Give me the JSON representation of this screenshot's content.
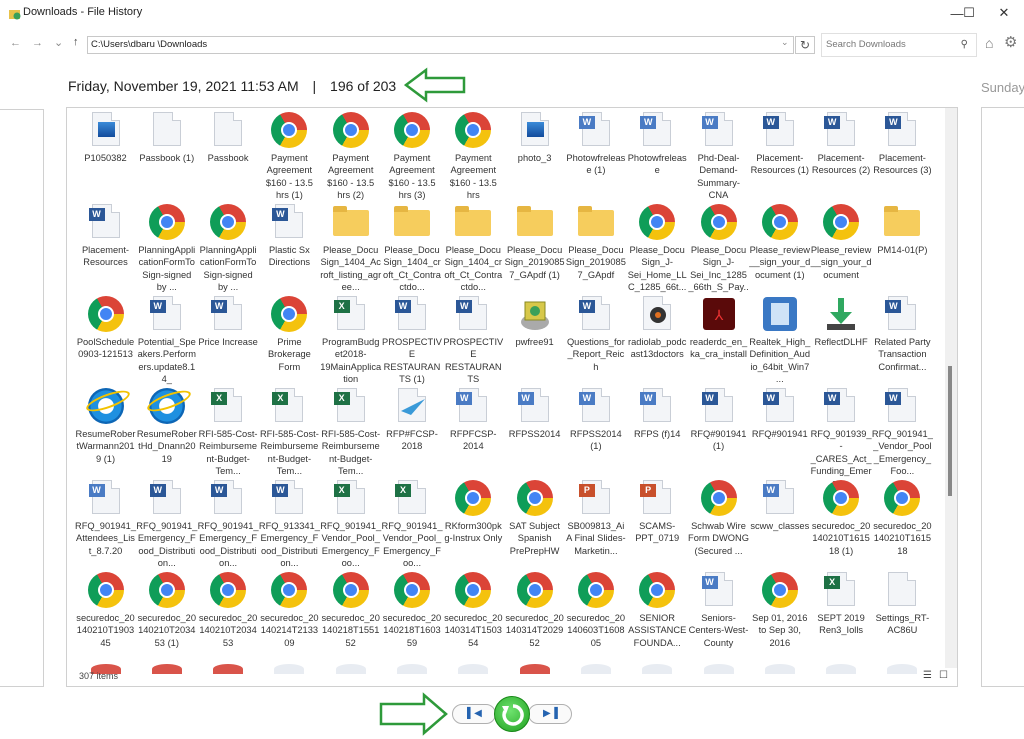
{
  "window": {
    "title": "Downloads - File History",
    "minimize_glyph": "—",
    "maximize_glyph": "☐",
    "close_glyph": "✕"
  },
  "nav": {
    "back_glyph": "←",
    "forward_glyph": "→",
    "recent_glyph": "⌄",
    "up_glyph": "↑",
    "address": "C:\\Users\\dbaru \\Downloads",
    "address_dropdown_glyph": "⌄",
    "refresh_glyph": "↻",
    "search_placeholder": "Search Downloads",
    "search_glyph": "⚲",
    "home_glyph": "⌂",
    "settings_glyph": "⚙"
  },
  "header": {
    "date": "Friday, November 19, 2021 11:53 AM",
    "separator": "|",
    "position": "196 of 203",
    "next_snapshot_peek": "Sunday"
  },
  "files": [
    {
      "name": "P1050382",
      "type": "image"
    },
    {
      "name": "Passbook (1)",
      "type": "blank"
    },
    {
      "name": "Passbook",
      "type": "blank"
    },
    {
      "name": "Payment Agreement $160 - 13.5 hrs (1)",
      "type": "chrome"
    },
    {
      "name": "Payment Agreement $160 - 13.5 hrs (2)",
      "type": "chrome"
    },
    {
      "name": "Payment Agreement $160 - 13.5 hrs (3)",
      "type": "chrome"
    },
    {
      "name": "Payment Agreement $160 - 13.5 hrs",
      "type": "chrome"
    },
    {
      "name": "photo_3",
      "type": "image"
    },
    {
      "name": "Photowfrelease (1)",
      "type": "word-old"
    },
    {
      "name": "Photowfrelease",
      "type": "word-old"
    },
    {
      "name": "Phd-Deal-Demand-Summary-CNA",
      "type": "word-old"
    },
    {
      "name": "Placement-Resources (1)",
      "type": "word"
    },
    {
      "name": "Placement-Resources (2)",
      "type": "word"
    },
    {
      "name": "Placement-Resources (3)",
      "type": "word"
    },
    {
      "name": "Placement-Resources",
      "type": "word"
    },
    {
      "name": "PlanningApplicationFormToSign-signed by ...",
      "type": "chrome"
    },
    {
      "name": "PlanningApplicationFormToSign-signed by ...",
      "type": "chrome"
    },
    {
      "name": "Plastic Sx Directions",
      "type": "word"
    },
    {
      "name": "Please_DocuSign_1404_Acroft_listing_agree...",
      "type": "zip"
    },
    {
      "name": "Please_DocuSign_1404_croft_Ct_Contractdo...",
      "type": "zip"
    },
    {
      "name": "Please_DocuSign_1404_croft_Ct_Contractdo...",
      "type": "zip"
    },
    {
      "name": "Please_DocuSign_20190857_GApdf (1)",
      "type": "zip"
    },
    {
      "name": "Please_DocuSign_20190857_GApdf",
      "type": "zip"
    },
    {
      "name": "Please_DocuSign_J-Sei_Home_LLC_1285_66t...",
      "type": "chrome"
    },
    {
      "name": "Please_DocuSign_J-Sei_Inc_1285_66th_S_Pay...",
      "type": "chrome"
    },
    {
      "name": "Please_review__sign_your_document (1)",
      "type": "chrome"
    },
    {
      "name": "Please_review__sign_your_document",
      "type": "chrome"
    },
    {
      "name": "PM14-01(P)",
      "type": "zip"
    },
    {
      "name": "PoolSchedule0903-121513",
      "type": "chrome"
    },
    {
      "name": "Potential_Speakers.Performers.update8.14_",
      "type": "word"
    },
    {
      "name": "Price Increase",
      "type": "word"
    },
    {
      "name": "Prime Brokerage Form",
      "type": "chrome"
    },
    {
      "name": "ProgramBudget2018-19MainApplication",
      "type": "excel"
    },
    {
      "name": "PROSPECTIVE RESTAURANTS (1)",
      "type": "word"
    },
    {
      "name": "PROSPECTIVE RESTAURANTS",
      "type": "word"
    },
    {
      "name": "pwfree91",
      "type": "installer"
    },
    {
      "name": "Questions_for_Report_Reich",
      "type": "word"
    },
    {
      "name": "radiolab_podcast13doctors",
      "type": "audio"
    },
    {
      "name": "readerdc_en_ka_cra_install",
      "type": "acrobat"
    },
    {
      "name": "Realtek_High_Definition_Audio_64bit_Win7...",
      "type": "realtek"
    },
    {
      "name": "ReflectDLHF",
      "type": "download"
    },
    {
      "name": "Related Party Transaction Confirmat...",
      "type": "word"
    },
    {
      "name": "ResumeRobertWarmann2019 (1)",
      "type": "ie"
    },
    {
      "name": "ResumeRobertHd_Dnann2019",
      "type": "ie"
    },
    {
      "name": "RFI-585-Cost-Reimbursement-Budget-Tem...",
      "type": "excel"
    },
    {
      "name": "RFI-585-Cost-Reimbursement-Budget-Tem...",
      "type": "excel"
    },
    {
      "name": "RFI-585-Cost-Reimbursement-Budget-Tem...",
      "type": "excel"
    },
    {
      "name": "RFP#FCSP-2018",
      "type": "plane"
    },
    {
      "name": "RFPFCSP-2014",
      "type": "word-old"
    },
    {
      "name": "RFPSS2014",
      "type": "word-old"
    },
    {
      "name": "RFPSS2014 (1)",
      "type": "word-old"
    },
    {
      "name": "RFPS (f)14",
      "type": "word-old"
    },
    {
      "name": "RFQ#901941 (1)",
      "type": "word"
    },
    {
      "name": "RFQ#901941",
      "type": "word"
    },
    {
      "name": "RFQ_901939_-_CARES_Act_Funding_Emerge...",
      "type": "word"
    },
    {
      "name": "RFQ_901941__Vendor_Pool_Emergency_Foo...",
      "type": "word"
    },
    {
      "name": "RFQ_901941_Attendees_List_8.7.20",
      "type": "word-old"
    },
    {
      "name": "RFQ_901941_Emergency_Food_Distribution...",
      "type": "word"
    },
    {
      "name": "RFQ_901941_Emergency_Food_Distribution...",
      "type": "word"
    },
    {
      "name": "RFQ_913341_Emergency_Food_Distribution...",
      "type": "word"
    },
    {
      "name": "RFQ_901941_Vendor_Pool_Emergency_Foo...",
      "type": "excel"
    },
    {
      "name": "RFQ_901941_Vendor_Pool_Emergency_Foo...",
      "type": "excel"
    },
    {
      "name": "RKform300pkg-Instrux Only",
      "type": "chrome"
    },
    {
      "name": "SAT Subject Spanish PrePrepHW",
      "type": "chrome"
    },
    {
      "name": "SB009813_AiA Final Slides-Marketin...",
      "type": "ppt"
    },
    {
      "name": "SCAMS-PPT_0719",
      "type": "ppt"
    },
    {
      "name": "Schwab Wire Form DWONG (Secured ...",
      "type": "chrome"
    },
    {
      "name": "scww_classes",
      "type": "word-old"
    },
    {
      "name": "securedoc_20140210T161518 (1)",
      "type": "chrome"
    },
    {
      "name": "securedoc_20140210T161518",
      "type": "chrome"
    },
    {
      "name": "securedoc_20140210T190345",
      "type": "chrome"
    },
    {
      "name": "securedoc_20140210T203453 (1)",
      "type": "chrome"
    },
    {
      "name": "securedoc_20140210T203453",
      "type": "chrome"
    },
    {
      "name": "securedoc_20140214T213309",
      "type": "chrome"
    },
    {
      "name": "securedoc_20140218T155152",
      "type": "chrome"
    },
    {
      "name": "securedoc_20140218T160359",
      "type": "chrome"
    },
    {
      "name": "securedoc_20140314T150354",
      "type": "chrome"
    },
    {
      "name": "securedoc_20140314T202952",
      "type": "chrome"
    },
    {
      "name": "securedoc_20140603T160805",
      "type": "chrome"
    },
    {
      "name": "SENIOR ASSISTANCE FOUNDA...",
      "type": "chrome"
    },
    {
      "name": "Seniors-Centers-West-County",
      "type": "word-old"
    },
    {
      "name": "Sep 01, 2016 to Sep 30, 2016",
      "type": "chrome"
    },
    {
      "name": "SEPT 2019 Ren3_Iolls",
      "type": "excel"
    },
    {
      "name": "Settings_RT-AC86U",
      "type": "blank"
    }
  ],
  "status": {
    "item_count": "307 items",
    "details_view_glyph": "☰",
    "large_icons_glyph": "☐"
  },
  "playback": {
    "previous_glyph": "⏮",
    "restore_glyph": "⟲",
    "next_glyph": "⏭"
  },
  "annotation_color": "#2e9a3a",
  "scroll_position_fraction": 0.52
}
